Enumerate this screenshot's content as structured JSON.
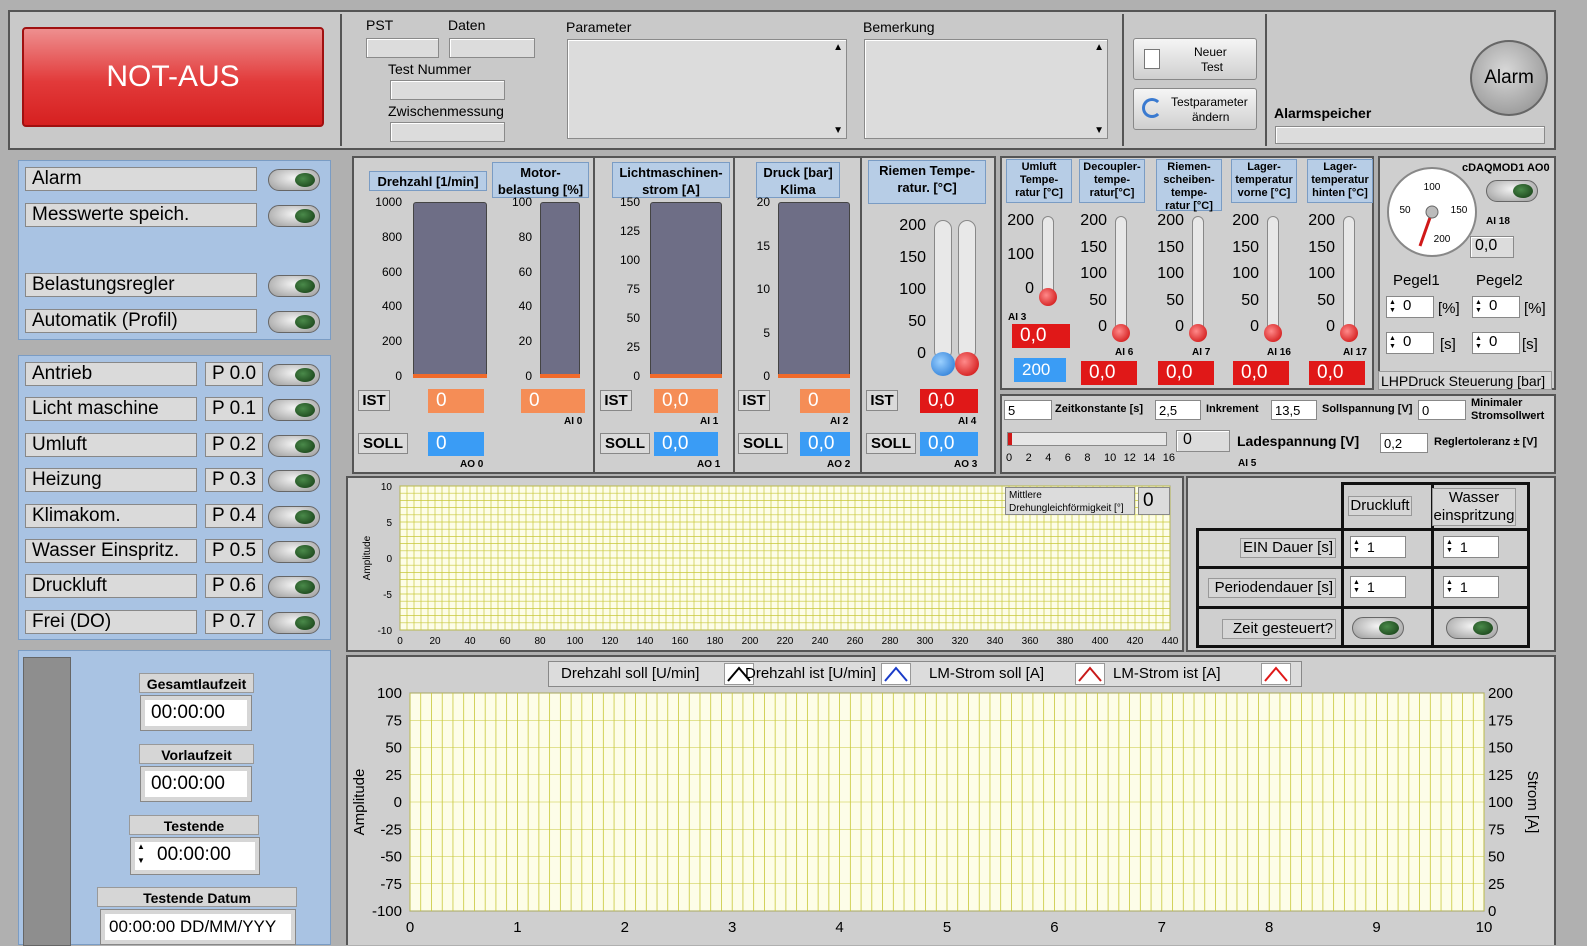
{
  "top": {
    "not_aus": "NOT-AUS",
    "pst": "PST",
    "daten": "Daten",
    "test_nummer": "Test Nummer",
    "zwischenmessung": "Zwischenmessung",
    "parameter": "Parameter",
    "bemerkung": "Bemerkung",
    "neuer_test_1": "Neuer",
    "neuer_test_2": "Test",
    "testparam_1": "Testparameter",
    "testparam_2": "ändern",
    "alarmspeicher": "Alarmspeicher",
    "alarm": "Alarm"
  },
  "sidebar": {
    "group1": [
      {
        "label": "Alarm"
      },
      {
        "label": "Messwerte speich."
      },
      {
        "label": ""
      },
      {
        "label": "Belastungsregler"
      },
      {
        "label": "Automatik (Profil)"
      }
    ],
    "group2": [
      {
        "label": "Antrieb",
        "code": "P 0.0"
      },
      {
        "label": "Licht maschine",
        "code": "P 0.1"
      },
      {
        "label": "Umluft",
        "code": "P 0.2"
      },
      {
        "label": "Heizung",
        "code": "P 0.3"
      },
      {
        "label": "Klimakom.",
        "code": "P 0.4"
      },
      {
        "label": "Wasser Einspritz.",
        "code": "P 0.5"
      },
      {
        "label": "Druckluft",
        "code": "P 0.6"
      },
      {
        "label": "Frei (DO)",
        "code": "P 0.7"
      }
    ],
    "gesamtlaufzeit": "Gesamtlaufzeit",
    "gesamtlaufzeit_val": "00:00:00",
    "vorlaufzeit": "Vorlaufzeit",
    "vorlaufzeit_val": "00:00:00",
    "testende": "Testende",
    "testende_val": "00:00:00",
    "testende_datum": "Testende Datum",
    "testende_datum_val": "00:00:00 DD/MM/YYY"
  },
  "gauges": {
    "drehzahl": {
      "title": "Drehzahl [1/min]",
      "ticks": [
        "1000",
        "800",
        "600",
        "400",
        "200",
        "0"
      ],
      "ist": "0",
      "soll": "0",
      "soll_tag": "AO 0"
    },
    "motor": {
      "title": "Motor-belastung [%]",
      "ticks": [
        "100",
        "80",
        "60",
        "40",
        "20",
        "0"
      ],
      "ist": "0",
      "ist_tag": "AI 0"
    },
    "licht": {
      "title": "Lichtmaschinen-strom [A]",
      "ticks": [
        "150",
        "125",
        "100",
        "75",
        "50",
        "25",
        "0"
      ],
      "ist": "0,0",
      "ist_tag": "AI 1",
      "soll": "0,0",
      "soll_tag": "AO 1"
    },
    "druck": {
      "title": "Druck [bar] Klima",
      "ticks": [
        "20",
        "15",
        "10",
        "5",
        "0"
      ],
      "ist": "0",
      "ist_tag": "AI 2",
      "soll": "0,0",
      "soll_tag": "AO 2"
    },
    "riemen": {
      "title": "Riemen Tempe-ratur. [°C]",
      "ticks": [
        "200",
        "150",
        "100",
        "50",
        "0"
      ],
      "ist": "0,0",
      "ist_tag": "AI 4",
      "soll": "0,0",
      "soll_tag": "AO 3"
    },
    "ist_label": "IST",
    "soll_label": "SOLL"
  },
  "temps": [
    {
      "title": "Umluft Tempe-ratur [°C]",
      "tag": "AI 3",
      "val": "0,0",
      "val2": "200"
    },
    {
      "title": "Decoupler-tempe-ratur[°C]",
      "tag": "AI 6",
      "val": "0,0"
    },
    {
      "title": "Riemen-scheiben-tempe-ratur [°C]",
      "tag": "AI 7",
      "val": "0,0"
    },
    {
      "title": "Lager-temperatur vorne [°C]",
      "tag": "AI 16",
      "val": "0,0"
    },
    {
      "title": "Lager-temperatur hinten [°C]",
      "tag": "AI 17",
      "val": "0,0"
    }
  ],
  "temp_ticks": [
    "200",
    "150",
    "100",
    "50",
    "0"
  ],
  "umluft_ticks": [
    "200",
    "100",
    "0"
  ],
  "dial": {
    "title": "cDAQMOD1 AO0",
    "tag": "AI 18",
    "value": "0,0",
    "marks": [
      "100",
      "50",
      "150",
      "200"
    ],
    "pegel1": "Pegel1",
    "pegel2": "Pegel2",
    "p1a": "0",
    "p1b": "0",
    "p2a": "0",
    "p2b": "0",
    "u_pct": "[%]",
    "u_s": "[s]",
    "lhp": "LHPDruck Steuerung [bar]"
  },
  "params": {
    "zk_val": "5",
    "zk": "Zeitkonstante [s]",
    "ink_val": "2,5",
    "ink": "Inkrement",
    "soll_val": "13,5",
    "soll": "Sollspannung [V]",
    "min_val": "0",
    "min": "Minimaler Stromsollwert",
    "lade": "Ladespannung [V]",
    "lade_val": "0",
    "ai5": "AI 5",
    "regl_val": "0,2",
    "regl": "Reglertoleranz ± [V]",
    "slider_ticks": [
      "0",
      "2",
      "4",
      "6",
      "8",
      "10",
      "12",
      "14",
      "16"
    ]
  },
  "chart1": {
    "ylabel": "Amplitude",
    "legend": "Mittlere Drehungleichförmigkeit [°]",
    "legend_val": "0",
    "y_ticks": [
      "10",
      "5",
      "0",
      "-5",
      "-10"
    ],
    "x_ticks": [
      "0",
      "20",
      "40",
      "60",
      "80",
      "100",
      "120",
      "140",
      "160",
      "180",
      "200",
      "220",
      "240",
      "260",
      "280",
      "300",
      "320",
      "340",
      "360",
      "380",
      "400",
      "420",
      "440"
    ]
  },
  "table": {
    "col1": "Druckluft",
    "col2_1": "Wasser",
    "col2_2": "einspritzung",
    "row1": "EIN Dauer [s]",
    "row2": "Periodendauer [s]",
    "row3": "Zeit gesteuert?",
    "v11": "1",
    "v12": "1",
    "v21": "1",
    "v22": "1"
  },
  "chart2": {
    "ylabel": "Amplitude",
    "y2label": "Strom [A]",
    "legend": [
      "Drehzahl soll [U/min]",
      "Drehzahl ist [U/min]",
      "LM-Strom soll [A]",
      "LM-Strom ist [A]"
    ],
    "legend_colors": [
      "#000000",
      "#1a3cc8",
      "#c81a1a",
      "#e01818"
    ],
    "y_ticks": [
      "100",
      "75",
      "50",
      "25",
      "0",
      "-25",
      "-50",
      "-75",
      "-100"
    ],
    "y2_ticks": [
      "200",
      "175",
      "150",
      "125",
      "100",
      "75",
      "50",
      "25",
      "0"
    ],
    "x_ticks": [
      "0",
      "1",
      "2",
      "3",
      "4",
      "5",
      "6",
      "7",
      "8",
      "9",
      "10"
    ]
  }
}
